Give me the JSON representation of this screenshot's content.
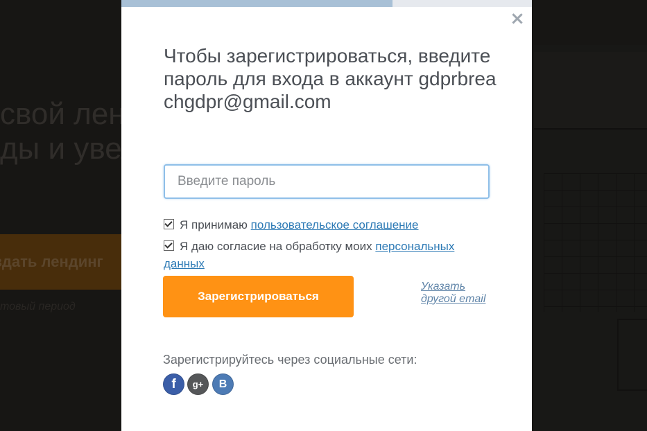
{
  "background": {
    "headline_lines": [
      "свой лен",
      "ды и увел"
    ],
    "cta_label": "здать лендинг",
    "note": "товый период"
  },
  "modal": {
    "progress_percent": 66,
    "close_icon": "close-icon",
    "title": "Чтобы зарегистрироваться, введите пароль для входа в аккаунт gdprbreachgdpr@gmail.com",
    "password_placeholder": "Введите пароль",
    "password_value": "",
    "agreement": {
      "checked": true,
      "text": "Я принимаю ",
      "link": "пользовательское соглашение"
    },
    "consent": {
      "checked": true,
      "text": "Я даю согласие на обработку моих ",
      "link": "персональных данных"
    },
    "submit_label": "Зарегистрироваться",
    "other_email_link": "Указать другой email",
    "social_label": "Зарегистрируйтесь через социальные сети:",
    "social": [
      {
        "icon": "facebook-icon",
        "glyph": "f",
        "color": "#3b5ea8"
      },
      {
        "icon": "google-plus-icon",
        "glyph": "g+",
        "color": "#555759"
      },
      {
        "icon": "vk-icon",
        "glyph": "B",
        "color": "#4d7bb5"
      }
    ],
    "accent_color": "#ff9214",
    "link_color": "#2d7ab5"
  }
}
